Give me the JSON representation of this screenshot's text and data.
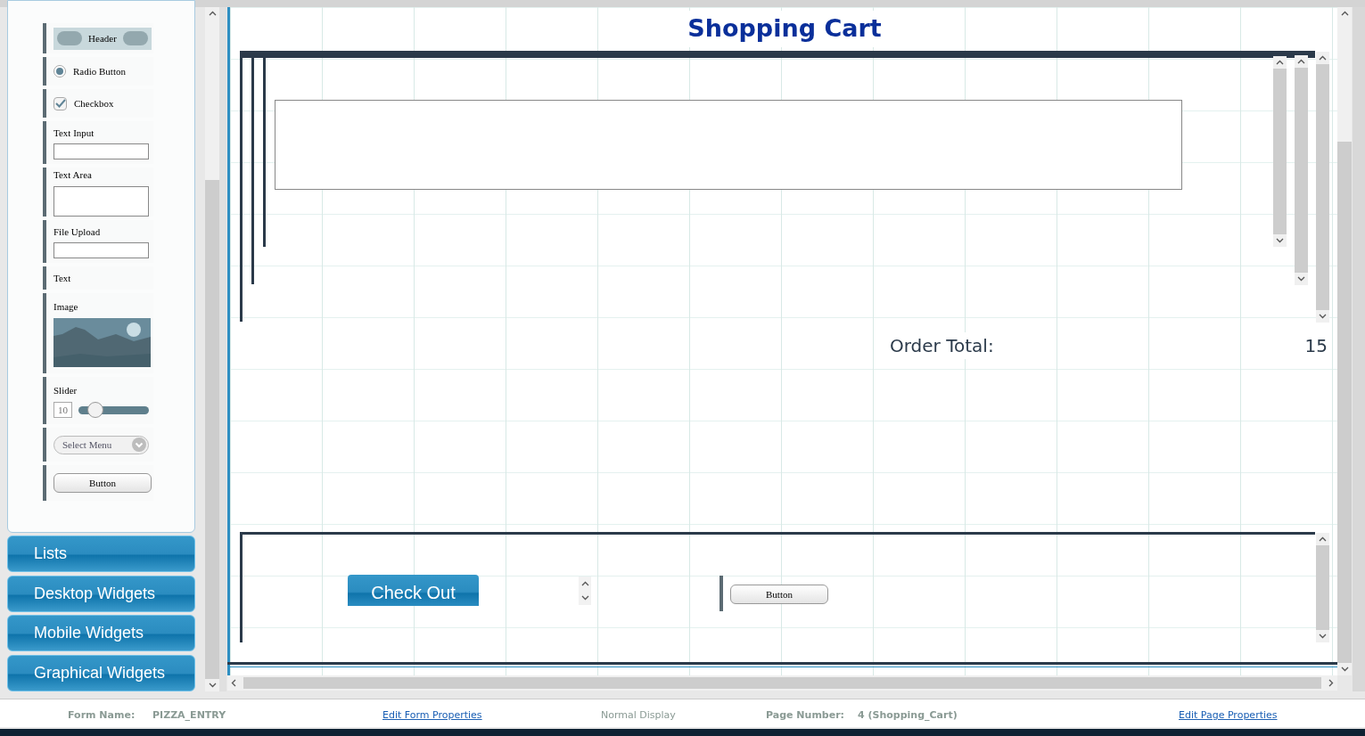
{
  "palette": {
    "items": [
      {
        "kind": "header",
        "label": "Header"
      },
      {
        "kind": "radio",
        "label": "Radio Button",
        "checked": true
      },
      {
        "kind": "checkbox",
        "label": "Checkbox",
        "checked": true
      },
      {
        "kind": "text_input",
        "label": "Text Input"
      },
      {
        "kind": "text_area",
        "label": "Text Area"
      },
      {
        "kind": "file_upload",
        "label": "File Upload"
      },
      {
        "kind": "text",
        "label": "Text"
      },
      {
        "kind": "image",
        "label": "Image"
      },
      {
        "kind": "slider",
        "label": "Slider",
        "value": "10",
        "level": 0.24
      },
      {
        "kind": "select",
        "label": "Select Menu"
      },
      {
        "kind": "button",
        "label": "Button"
      }
    ]
  },
  "categories": [
    "Lists",
    "Desktop Widgets",
    "Mobile Widgets",
    "Graphical Widgets"
  ],
  "canvas": {
    "title": "Shopping Cart",
    "order_total_label": "Order Total:",
    "order_total_value": "15",
    "checkout_button": "Check Out",
    "button": "Button"
  },
  "status_bar": {
    "form_name_label": "Form Name:",
    "form_name": "PIZZA_ENTRY",
    "edit_form_link": "Edit Form Properties",
    "display_mode": "Normal Display",
    "page_number_label": "Page Number:",
    "page_number": "4 (Shopping_Cart)",
    "edit_page_link": "Edit Page Properties"
  }
}
